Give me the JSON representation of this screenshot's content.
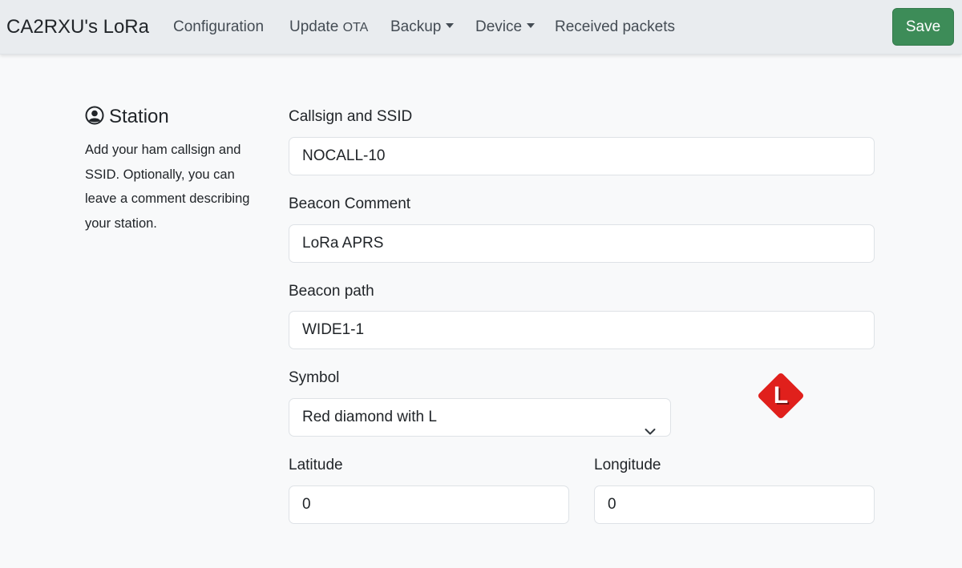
{
  "navbar": {
    "brand": "CA2RXU's LoRa",
    "links": {
      "configuration": "Configuration",
      "update": "Update",
      "update_small": "OTA",
      "backup": "Backup",
      "device": "Device",
      "received_packets": "Received packets"
    },
    "save_label": "Save"
  },
  "station": {
    "title": "Station",
    "description": "Add your ham callsign and SSID. Optionally, you can leave a comment describing your station."
  },
  "form": {
    "callsign": {
      "label": "Callsign and SSID",
      "value": "NOCALL-10"
    },
    "comment": {
      "label": "Beacon Comment",
      "value": "LoRa APRS"
    },
    "path": {
      "label": "Beacon path",
      "value": "WIDE1-1"
    },
    "symbol": {
      "label": "Symbol",
      "value": "Red diamond with L",
      "preview_letter": "L"
    },
    "latitude": {
      "label": "Latitude",
      "value": "0"
    },
    "longitude": {
      "label": "Longitude",
      "value": "0"
    }
  },
  "colors": {
    "navbar_bg": "#e9ecef",
    "save_button": "#3d8c58",
    "symbol_red": "#e0201c"
  },
  "icons": {
    "station": "user-circle-icon",
    "dropdown": "chevron-down-icon",
    "symbol": "red-diamond-l-icon"
  }
}
